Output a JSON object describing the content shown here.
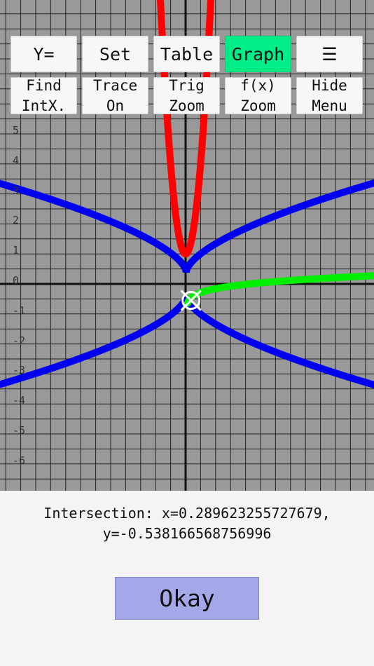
{
  "menu": {
    "row1": [
      {
        "label": "Y="
      },
      {
        "label": "Set"
      },
      {
        "label": "Table"
      },
      {
        "label": "Graph",
        "active": true
      },
      {
        "label": "☰"
      }
    ],
    "row2": [
      {
        "label": "Find\nIntX."
      },
      {
        "label": "Trace\nOn"
      },
      {
        "label": "Trig\nZoom"
      },
      {
        "label": "f(x)\nZoom"
      },
      {
        "label": "Hide\nMenu"
      }
    ]
  },
  "graph": {
    "y_ticks": [
      "5",
      "4",
      "3",
      "2",
      "1",
      "0",
      "-1",
      "-2",
      "-3",
      "-4",
      "-5",
      "-6"
    ],
    "colors": {
      "background": "#999999",
      "grid": "#222222",
      "axes": "#111111",
      "curve_red": "#ff0000",
      "curve_blue": "#0000ee",
      "curve_green": "#00ee00",
      "marker": "#ffffff"
    },
    "marker_icon": "crosshair-circle-icon"
  },
  "result": {
    "text": "Intersection: x=0.289623255727679,\ny=-0.538166568756996"
  },
  "okay": {
    "label": "Okay"
  }
}
